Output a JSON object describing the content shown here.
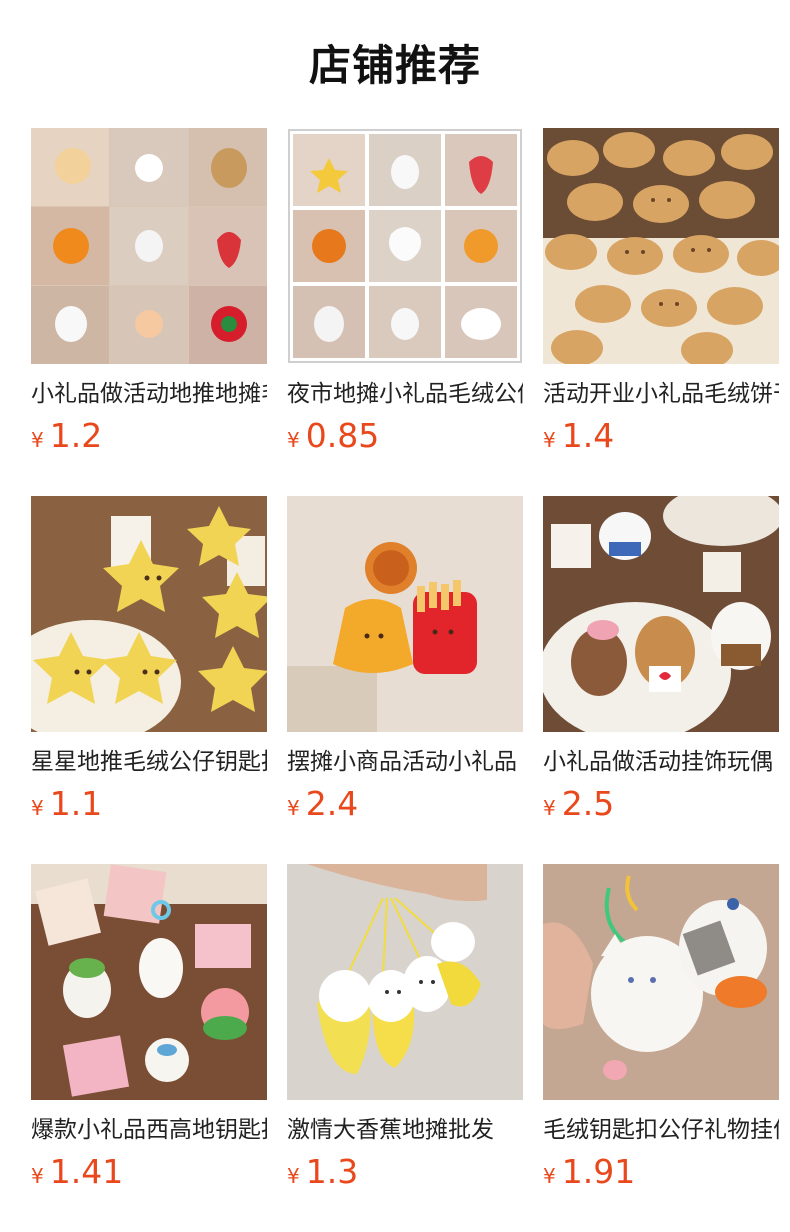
{
  "title": "店铺推荐",
  "price_color": "#e8481b",
  "products": [
    {
      "name": "小礼品做活动地推地摊毛绒",
      "currency": "¥",
      "price": "1.2",
      "image": "plush-keychain-grid-9"
    },
    {
      "name": "夜市地摊小礼品毛绒公仔",
      "currency": "¥",
      "price": "0.85",
      "image": "plush-keychain-grid-9-framed"
    },
    {
      "name": "活动开业小礼品毛绒饼干",
      "currency": "¥",
      "price": "1.4",
      "image": "cookie-plush-pile"
    },
    {
      "name": "星星地推毛绒公仔钥匙扣",
      "currency": "¥",
      "price": "1.1",
      "image": "star-plush"
    },
    {
      "name": "摆摊小商品活动小礼品",
      "currency": "¥",
      "price": "2.4",
      "image": "fries-plush"
    },
    {
      "name": "小礼品做活动挂饰玩偶",
      "currency": "¥",
      "price": "2.5",
      "image": "dog-bear-plush"
    },
    {
      "name": "爆款小礼品西高地钥匙扣",
      "currency": "¥",
      "price": "1.41",
      "image": "westie-plush"
    },
    {
      "name": "激情大香蕉地摊批发",
      "currency": "¥",
      "price": "1.3",
      "image": "banana-plush"
    },
    {
      "name": "毛绒钥匙扣公仔礼物挂件",
      "currency": "¥",
      "price": "1.91",
      "image": "cat-duck-plush"
    }
  ]
}
